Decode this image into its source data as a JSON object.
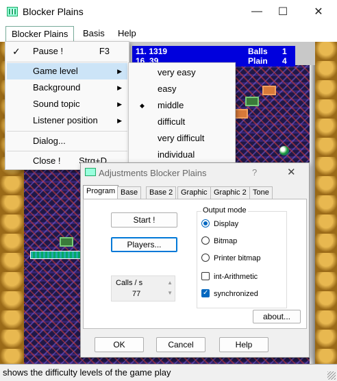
{
  "window": {
    "title": "Blocker Plains",
    "minimize": "—",
    "maximize": "☐",
    "close": "✕"
  },
  "menubar": {
    "items": [
      "Blocker Plains",
      "Basis",
      "Help"
    ]
  },
  "scoreboard": {
    "value1": "11. 1319",
    "value2": "16. 39",
    "label1": "Balls",
    "label2": "Plain",
    "num1": "1",
    "num2": "4"
  },
  "menu": {
    "items": [
      {
        "label": "Pause !",
        "accel": "F3",
        "checked": true
      },
      {
        "label": "Game level",
        "submenu": true,
        "highlighted": true
      },
      {
        "label": "Background",
        "submenu": true
      },
      {
        "label": "Sound topic",
        "submenu": true
      },
      {
        "label": "Listener position",
        "submenu": true
      },
      {
        "label": "Dialog..."
      },
      {
        "label": "Close !",
        "accel": "Strg+D"
      }
    ]
  },
  "submenu": {
    "items": [
      "very easy",
      "easy",
      "middle",
      "difficult",
      "very difficult",
      "individual"
    ],
    "selected": "middle"
  },
  "dialog": {
    "title": "Adjustments Blocker Plains",
    "help": "?",
    "close": "✕",
    "tabs": [
      "Program",
      "Base",
      "Base 2",
      "Graphic",
      "Graphic 2",
      "Tone"
    ],
    "active_tab": "Program",
    "start_label": "Start !",
    "players_label": "Players...",
    "calls_label": "Calls / s",
    "calls_value": "77",
    "output_label": "Output mode",
    "radios": [
      "Display",
      "Bitmap",
      "Printer bitmap"
    ],
    "radio_selected": "Display",
    "check_int": "int-Arithmetic",
    "check_sync": "synchronized",
    "check_int_checked": false,
    "check_sync_checked": true,
    "about_label": "about...",
    "ok_label": "OK",
    "cancel_label": "Cancel",
    "help_label": "Help"
  },
  "status": {
    "text": "shows the difficulty levels of the game play"
  }
}
